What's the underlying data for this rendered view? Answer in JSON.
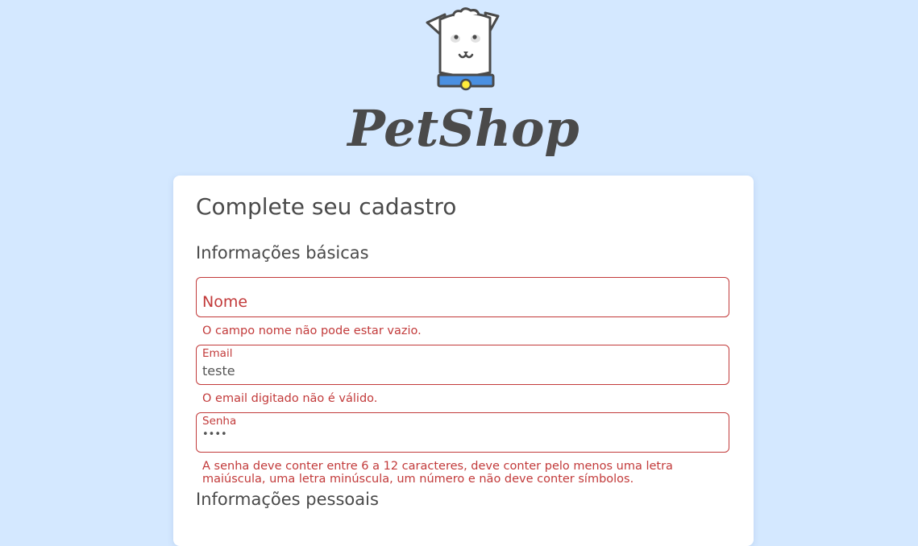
{
  "brand": {
    "name": "PetShop",
    "logo_icon": "dog-mascot-icon"
  },
  "form": {
    "title": "Complete seu cadastro",
    "sections": {
      "basic": "Informações básicas",
      "personal": "Informações pessoais"
    },
    "fields": {
      "name": {
        "label": "Nome",
        "value": "",
        "error": "O campo nome não pode estar vazio."
      },
      "email": {
        "label": "Email",
        "value": "teste",
        "error": "O email digitado não é válido."
      },
      "password": {
        "label": "Senha",
        "value": "••••",
        "error": "A senha deve conter entre 6 a 12 caracteres, deve conter pelo menos uma letra maiúscula, uma letra minúscula, um número e não deve conter símbolos."
      }
    }
  },
  "colors": {
    "background": "#d4e8ff",
    "card": "#ffffff",
    "error": "#c23a3a",
    "text": "#4a4a4a",
    "collar": "#4a90e2",
    "tag": "#ffeb3b"
  }
}
